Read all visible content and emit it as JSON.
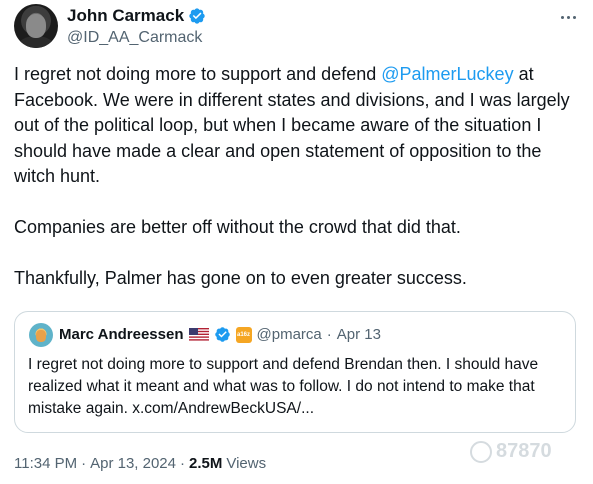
{
  "author": {
    "display_name": "John Carmack",
    "handle": "@ID_AA_Carmack",
    "verified_icon": "verified-badge-icon"
  },
  "tweet": {
    "line1_before": "I regret not doing more to support and defend ",
    "mention": "@PalmerLuckey",
    "line1_after": " at Facebook. We were in different states and divisions, and I was largely out of the political loop, but when I became aware of the situation I should have made a clear and open statement of opposition to the witch hunt.",
    "paragraph2": "Companies are better off without the crowd that did that.",
    "paragraph3": "Thankfully, Palmer has gone on to even greater success."
  },
  "quote": {
    "display_name": "Marc Andreessen",
    "flag_icon": "us-flag-icon",
    "affiliate_badge": "a16z",
    "handle": "@pmarca",
    "separator": "·",
    "date": "Apr 13",
    "text": "I regret not doing more to support and defend Brendan then. I should have realized what it meant and what was to follow. I do not intend to make that mistake again. x.com/AndrewBeckUSA/..."
  },
  "meta": {
    "time": "11:34 PM",
    "separator1": "·",
    "date": "Apr 13, 2024",
    "separator2": "·",
    "views_count": "2.5M",
    "views_label": "Views"
  },
  "watermark": {
    "text": "87870"
  },
  "colors": {
    "link": "#1d9bf0",
    "muted": "#536471",
    "text": "#0f1419",
    "border": "#cfd9de"
  }
}
